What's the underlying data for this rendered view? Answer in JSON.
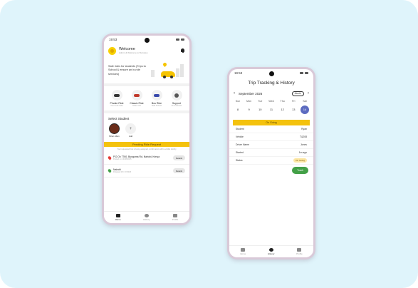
{
  "phone1": {
    "status_time": "19:53",
    "header": {
      "title": "Welcome",
      "subtitle": "Admin & Welcome to Bucodes"
    },
    "promo": {
      "text": "Safe rides for students (Trips to School & ensure an in-ride services)"
    },
    "services": [
      {
        "label": "Private Ride",
        "sub": "Commute Safe",
        "icon": "car-icon"
      },
      {
        "label": "Classic Ride",
        "sub": "Share ride",
        "icon": "van-icon"
      },
      {
        "label": "Bus Ride",
        "sub": "Bulk School",
        "icon": "bus-icon"
      },
      {
        "label": "Support",
        "sub": "24 Customer",
        "icon": "support-icon"
      }
    ],
    "select_student_title": "Select Student",
    "students": [
      {
        "name": "Brian Allan"
      },
      {
        "name": "Add"
      }
    ],
    "pending_banner": "Pending Ride Request",
    "pending_note": "Your requested ride is being assigned, confirmation will be visible shortly",
    "rides": [
      {
        "title": "P.O.Ox 7760, Bungoma Rd, Nairobi, Kenya",
        "sub": "Posted on 14/08/2025",
        "action": "Details",
        "pin_color": "#e53935"
      },
      {
        "title": "Nairobi",
        "sub": "Dropped 28 / 07/2025",
        "action": "Details",
        "pin_color": "#43a047"
      }
    ],
    "nav": [
      {
        "label": "Home",
        "active": true
      },
      {
        "label": "History",
        "active": false
      },
      {
        "label": "Profile",
        "active": false
      }
    ]
  },
  "phone2": {
    "status_time": "19:53",
    "title": "Trip Tracking & History",
    "calendar": {
      "month": "September 2026",
      "toggle": "Month",
      "days": [
        "Sun",
        "Mon",
        "Tue",
        "Wed",
        "Thu",
        "Fri",
        "Sat"
      ],
      "dates": [
        "8",
        "9",
        "10",
        "11",
        "12",
        "13",
        "14"
      ],
      "selected_index": 6
    },
    "trip_banner": "On Going",
    "details": [
      {
        "key": "Student",
        "value": "Ryan"
      },
      {
        "key": "Vehicle",
        "value": "T&208"
      },
      {
        "key": "Driver Name",
        "value": "Jones"
      },
      {
        "key": "Started",
        "value": "1m ago"
      },
      {
        "key": "Status",
        "value": "On Going"
      }
    ],
    "track_button": "Track",
    "nav": [
      {
        "label": "Home",
        "active": false
      },
      {
        "label": "History",
        "active": true
      },
      {
        "label": "Profile",
        "active": false
      }
    ]
  }
}
